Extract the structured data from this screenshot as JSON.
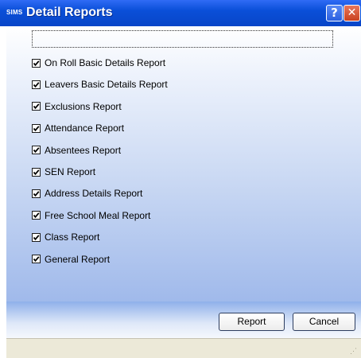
{
  "window": {
    "title": "Detail Reports",
    "logo": "SIMS",
    "help_glyph": "?",
    "close_glyph": "✕"
  },
  "items": [
    {
      "label": "On Roll Basic Details Report",
      "checked": true
    },
    {
      "label": "Leavers Basic Details Report",
      "checked": true
    },
    {
      "label": "Exclusions Report",
      "checked": true
    },
    {
      "label": "Attendance Report",
      "checked": true
    },
    {
      "label": "Absentees Report",
      "checked": true
    },
    {
      "label": "SEN Report",
      "checked": true
    },
    {
      "label": "Address Details Report",
      "checked": true
    },
    {
      "label": "Free School Meal Report",
      "checked": true
    },
    {
      "label": "Class Report",
      "checked": true
    },
    {
      "label": "General Report",
      "checked": true
    }
  ],
  "buttons": {
    "report": "Report",
    "cancel": "Cancel"
  },
  "colors": {
    "titlebar": "#0a4fd8",
    "client_bottom": "#9db7ea",
    "status": "#ece9d8"
  }
}
